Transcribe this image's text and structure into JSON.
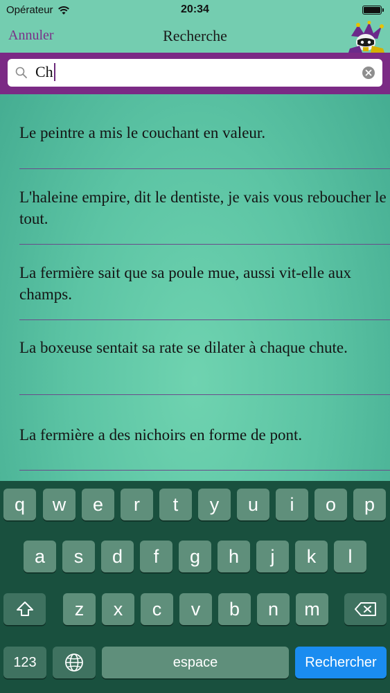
{
  "status_bar": {
    "carrier": "Opérateur",
    "time": "20:34"
  },
  "nav": {
    "cancel_label": "Annuler",
    "title": "Recherche"
  },
  "search": {
    "value": "Ch"
  },
  "results": [
    {
      "text": "Le peintre a mis le couchant en valeur."
    },
    {
      "text": "L'haleine empire, dit le dentiste, je vais vous reboucher le tout."
    },
    {
      "text": "La fermière sait que sa poule mue, aussi vit-elle aux champs."
    },
    {
      "text": "La boxeuse sentait sa rate se dilater à chaque chute."
    },
    {
      "text": "La fermière a des nichoirs en forme de pont."
    }
  ],
  "keyboard": {
    "row1": [
      "q",
      "w",
      "e",
      "r",
      "t",
      "y",
      "u",
      "i",
      "o",
      "p"
    ],
    "row2": [
      "a",
      "s",
      "d",
      "f",
      "g",
      "h",
      "j",
      "k",
      "l"
    ],
    "row3": [
      "z",
      "x",
      "c",
      "v",
      "b",
      "n",
      "m"
    ],
    "numbers_label": "123",
    "space_label": "espace",
    "return_label": "Rechercher",
    "icons": {
      "shift": "shift-icon",
      "delete": "delete-icon",
      "globe": "globe-icon"
    }
  },
  "colors": {
    "accent": "#7b2a85",
    "return_key": "#1a8cf0"
  }
}
